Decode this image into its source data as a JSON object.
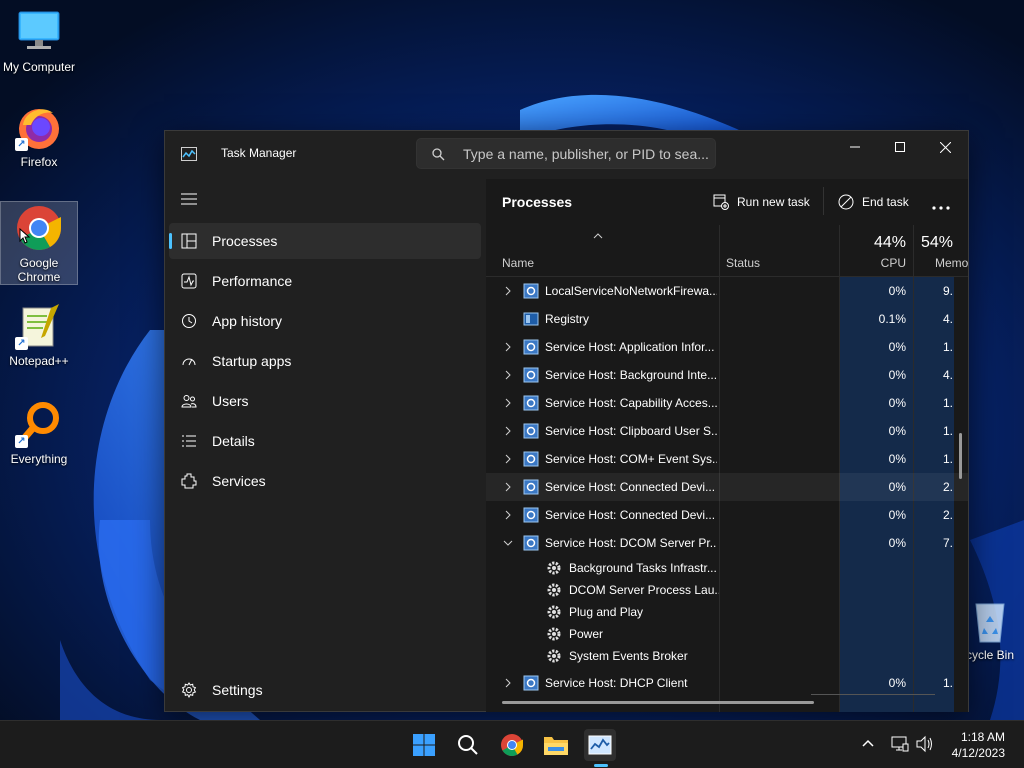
{
  "desktop": {
    "icons": [
      {
        "label": "My Computer",
        "icon": "monitor-icon",
        "shortcut": false
      },
      {
        "label": "Firefox",
        "icon": "firefox-icon",
        "shortcut": true
      },
      {
        "label": "Google Chrome",
        "icon": "chrome-icon",
        "shortcut": false,
        "selected": true
      },
      {
        "label": "Notepad++",
        "icon": "notepadpp-icon",
        "shortcut": true
      },
      {
        "label": "Everything",
        "icon": "everything-icon",
        "shortcut": true
      },
      {
        "label": "cycle Bin",
        "icon": "recycle-bin-icon",
        "shortcut": false
      }
    ]
  },
  "window": {
    "title": "Task Manager",
    "search_placeholder": "Type a name, publisher, or PID to sea...",
    "controls": [
      "minimize",
      "maximize",
      "close"
    ]
  },
  "sidebar": {
    "items": [
      {
        "label": "Processes",
        "icon": "processes-icon",
        "active": true
      },
      {
        "label": "Performance",
        "icon": "performance-icon"
      },
      {
        "label": "App history",
        "icon": "app-history-icon"
      },
      {
        "label": "Startup apps",
        "icon": "startup-apps-icon"
      },
      {
        "label": "Users",
        "icon": "users-icon"
      },
      {
        "label": "Details",
        "icon": "details-icon"
      },
      {
        "label": "Services",
        "icon": "services-icon"
      }
    ],
    "settings_label": "Settings"
  },
  "main": {
    "title": "Processes",
    "run_new_task_label": "Run new task",
    "end_task_label": "End task",
    "more_label": "...",
    "columns": {
      "name": "Name",
      "status": "Status",
      "cpu_pct": "44%",
      "cpu": "CPU",
      "mem_pct": "54%",
      "mem": "Memo"
    },
    "rows": [
      {
        "name": "LocalServiceNoNetworkFirewa...",
        "cpu": "0%",
        "mem": "9.",
        "expand": "right",
        "icon": "service-host-icon"
      },
      {
        "name": "Registry",
        "cpu": "0.1%",
        "mem": "4.",
        "expand": "none",
        "icon": "registry-icon"
      },
      {
        "name": "Service Host: Application Infor...",
        "cpu": "0%",
        "mem": "1.",
        "expand": "right",
        "icon": "service-host-icon"
      },
      {
        "name": "Service Host: Background Inte...",
        "cpu": "0%",
        "mem": "4.",
        "expand": "right",
        "icon": "service-host-icon"
      },
      {
        "name": "Service Host: Capability Acces...",
        "cpu": "0%",
        "mem": "1.",
        "expand": "right",
        "icon": "service-host-icon"
      },
      {
        "name": "Service Host: Clipboard User S...",
        "cpu": "0%",
        "mem": "1.",
        "expand": "right",
        "icon": "service-host-icon"
      },
      {
        "name": "Service Host: COM+ Event Sys...",
        "cpu": "0%",
        "mem": "1.",
        "expand": "right",
        "icon": "service-host-icon"
      },
      {
        "name": "Service Host: Connected Devi...",
        "cpu": "0%",
        "mem": "2.",
        "expand": "right",
        "icon": "service-host-icon",
        "hover": true
      },
      {
        "name": "Service Host: Connected Devi...",
        "cpu": "0%",
        "mem": "2.",
        "expand": "right",
        "icon": "service-host-icon"
      },
      {
        "name": "Service Host: DCOM Server Pr...",
        "cpu": "0%",
        "mem": "7.",
        "expand": "down",
        "icon": "service-host-icon"
      }
    ],
    "children": [
      {
        "name": "Background Tasks Infrastr...",
        "icon": "gear-icon"
      },
      {
        "name": "DCOM Server Process Lau...",
        "icon": "gear-icon"
      },
      {
        "name": "Plug and Play",
        "icon": "gear-icon"
      },
      {
        "name": "Power",
        "icon": "gear-icon"
      },
      {
        "name": "System Events Broker",
        "icon": "gear-icon"
      }
    ],
    "last_row": {
      "name": "Service Host: DHCP Client",
      "cpu": "0%",
      "mem": "1.",
      "expand": "right",
      "icon": "service-host-icon"
    }
  },
  "taskbar": {
    "apps": [
      "start-icon",
      "search-icon",
      "chrome-icon",
      "file-explorer-icon",
      "task-manager-icon"
    ],
    "time": "1:18 AM",
    "date": "4/12/2023"
  },
  "colors": {
    "accent": "#4cc2ff",
    "window_bg": "#202020",
    "content_bg": "#191919",
    "column_highlight": "#142a4a"
  }
}
